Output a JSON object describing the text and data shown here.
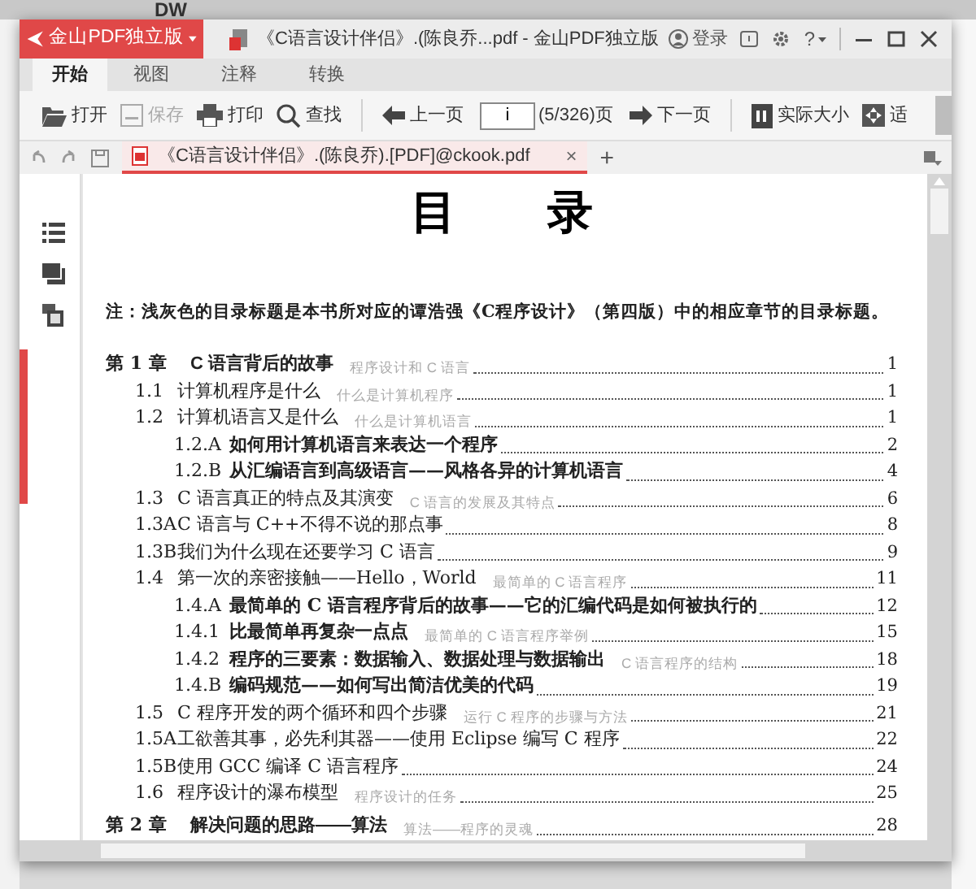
{
  "background_app": {
    "logo": "DW"
  },
  "window": {
    "app_button": "金山PDF独立版",
    "title": "《C语言设计伴侣》.(陈良乔...pdf - 金山PDF独立版",
    "login": "登录",
    "help": "?"
  },
  "tabs": [
    {
      "label": "开始",
      "selected": true
    },
    {
      "label": "视图",
      "selected": false
    },
    {
      "label": "注释",
      "selected": false
    },
    {
      "label": "转换",
      "selected": false
    }
  ],
  "toolbar": [
    {
      "kind": "open",
      "label": "打开",
      "disabled": false
    },
    {
      "kind": "save",
      "label": "保存",
      "disabled": true
    },
    {
      "kind": "print",
      "label": "打印",
      "disabled": false
    },
    {
      "kind": "find",
      "label": "查找",
      "disabled": false
    },
    {
      "kind": "prev",
      "label": "上一页",
      "disabled": false
    },
    {
      "kind": "page",
      "value": "i",
      "label": "(5/326)页"
    },
    {
      "kind": "next",
      "label": "下一页",
      "disabled": false
    },
    {
      "kind": "actual",
      "label": "实际大小",
      "disabled": false
    },
    {
      "kind": "fit",
      "label": "适",
      "disabled": false
    }
  ],
  "document_tab": {
    "label": "《C语言设计伴侣》.(陈良乔).[PDF]@ckook.pdf",
    "close": "×",
    "new": "+"
  },
  "page": {
    "title": "目　　录",
    "note": "注：浅灰色的目录标题是本书所对应的谭浩强《C程序设计》（第四版）中的相应章节的目录标题。",
    "toc": [
      {
        "kind": "chapter",
        "number": "第 1 章",
        "title": "C 语言背后的故事",
        "original": "程序设计和 C 语言",
        "page": "1"
      },
      {
        "kind": "section",
        "number": "1.1",
        "title": "计算机程序是什么",
        "original": "什么是计算机程序",
        "page": "1"
      },
      {
        "kind": "section",
        "number": "1.2",
        "title": "计算机语言又是什么",
        "original": "什么是计算机语言",
        "page": "1"
      },
      {
        "kind": "subsection",
        "number": "1.2.A",
        "title": "如何用计算机语言来表达一个程序",
        "page": "2"
      },
      {
        "kind": "subsection",
        "number": "1.2.B",
        "title": "从汇编语言到高级语言——风格各异的计算机语言",
        "page": "4"
      },
      {
        "kind": "section",
        "number": "1.3",
        "title": "C 语言真正的特点及其演变",
        "original": "C 语言的发展及其特点",
        "page": "6"
      },
      {
        "kind": "section",
        "number": "1.3A",
        "title": "C 语言与 C++不得不说的那点事",
        "page": "8"
      },
      {
        "kind": "section",
        "number": "1.3B",
        "title": "我们为什么现在还要学习 C 语言",
        "page": "9"
      },
      {
        "kind": "section",
        "number": "1.4",
        "title": "第一次的亲密接触——Hello，World",
        "original": "最简单的 C 语言程序",
        "page": "11"
      },
      {
        "kind": "subsection",
        "number": "1.4.A",
        "title": "最简单的 C 语言程序背后的故事——它的汇编代码是如何被执行的",
        "page": "12"
      },
      {
        "kind": "subsection",
        "number": "1.4.1",
        "title": "比最简单再复杂一点点",
        "original": "最简单的 C 语言程序举例",
        "page": "15"
      },
      {
        "kind": "subsection",
        "number": "1.4.2",
        "title": "程序的三要素：数据输入、数据处理与数据输出",
        "original": "C 语言程序的结构",
        "page": "18"
      },
      {
        "kind": "subsection",
        "number": "1.4.B",
        "title": "编码规范——如何写出简洁优美的代码",
        "page": "19"
      },
      {
        "kind": "section",
        "number": "1.5",
        "title": "C 程序开发的两个循环和四个步骤",
        "original": "运行 C 程序的步骤与方法",
        "page": "21"
      },
      {
        "kind": "section",
        "number": "1.5A",
        "title": "工欲善其事，必先利其器——使用 Eclipse 编写 C 程序",
        "page": "22"
      },
      {
        "kind": "section",
        "number": "1.5B",
        "title": "使用 GCC 编译 C 语言程序",
        "page": "24"
      },
      {
        "kind": "section",
        "number": "1.6",
        "title": "程序设计的瀑布模型",
        "original": "程序设计的任务",
        "page": "25"
      },
      {
        "kind": "chapter",
        "number": "第 2 章",
        "title": "解决问题的思路——算法",
        "original": "算法——程序的灵魂",
        "page": "28"
      }
    ]
  }
}
